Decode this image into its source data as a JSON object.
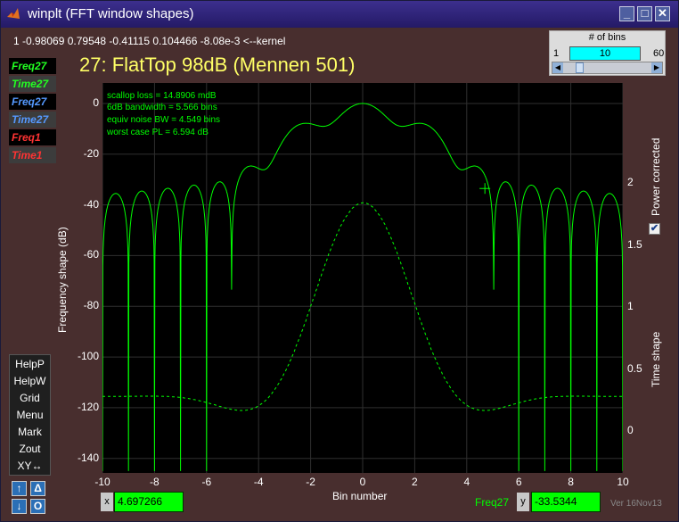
{
  "window": {
    "title": "winplt (FFT window shapes)",
    "min_glyph": "_",
    "max_glyph": "□",
    "close_glyph": "✕",
    "app_icon": "matlab-icon"
  },
  "kernel_line": "1   -0.98069   0.79548   -0.41115   0.104466   -8.08e-3   <--kernel",
  "plot_title": "27: FlatTop  98dB (Mennen 501)",
  "legend_items": [
    {
      "label": "Freq27",
      "color": "#22ff22",
      "bg": "#000000"
    },
    {
      "label": "Time27",
      "color": "#22ff22",
      "bg": "#3c3c3c"
    },
    {
      "label": "Freq27",
      "color": "#5599ff",
      "bg": "#000000"
    },
    {
      "label": "Time27",
      "color": "#5599ff",
      "bg": "#3c3c3c"
    },
    {
      "label": "Freq1",
      "color": "#ff3333",
      "bg": "#000000"
    },
    {
      "label": "Time1",
      "color": "#ff3333",
      "bg": "#3c3c3c"
    }
  ],
  "bins": {
    "label": "# of bins",
    "min": "1",
    "max": "60",
    "value": "10",
    "fraction": 0.153
  },
  "help_buttons": [
    "HelpP",
    "HelpW",
    "Grid",
    "Menu",
    "Mark",
    "Zout",
    "XY↔"
  ],
  "small_buttons": [
    "↑",
    "Δ",
    "↓",
    "O"
  ],
  "annotations": [
    "scallop loss = 14.8906 mdB",
    "6dB bandwidth = 5.566 bins",
    "equiv noise BW = 4.549 bins",
    "worst case PL = 6.594 dB"
  ],
  "cursor": {
    "x_label": "x",
    "x_value": "4.697266",
    "y_label": "y",
    "y_value": "-33.5344",
    "trace": "Freq27"
  },
  "power_corrected": {
    "label": "Power corrected",
    "checked": true
  },
  "version": "Ver 16Nov13",
  "chart_data": {
    "type": "line",
    "xlabel": "Bin number",
    "ylabel": "Frequency shape (dB)",
    "y2label": "Time shape",
    "xlim": [
      -10,
      10
    ],
    "ylim": [
      -145,
      5
    ],
    "y2lim": [
      -0.3,
      2.3
    ],
    "x_ticks": [
      "-10",
      "-8",
      "-6",
      "-4",
      "-2",
      "0",
      "2",
      "4",
      "6",
      "8",
      "10"
    ],
    "y_ticks": [
      "0",
      "-20",
      "-40",
      "-60",
      "-80",
      "-100",
      "-120",
      "-140"
    ],
    "y2_ticks": [
      "2",
      "1.5",
      "1",
      "0.5",
      "0"
    ],
    "series": [
      {
        "name": "Freq27",
        "style": "solid",
        "color": "#00ff00"
      },
      {
        "name": "Time27",
        "style": "dashed",
        "color": "#00ff00"
      }
    ],
    "marker": {
      "x": 4.697266,
      "y": -33.5344
    },
    "kernel": [
      1,
      -0.98069,
      0.79548,
      -0.41115,
      0.104466,
      -0.00808
    ]
  }
}
